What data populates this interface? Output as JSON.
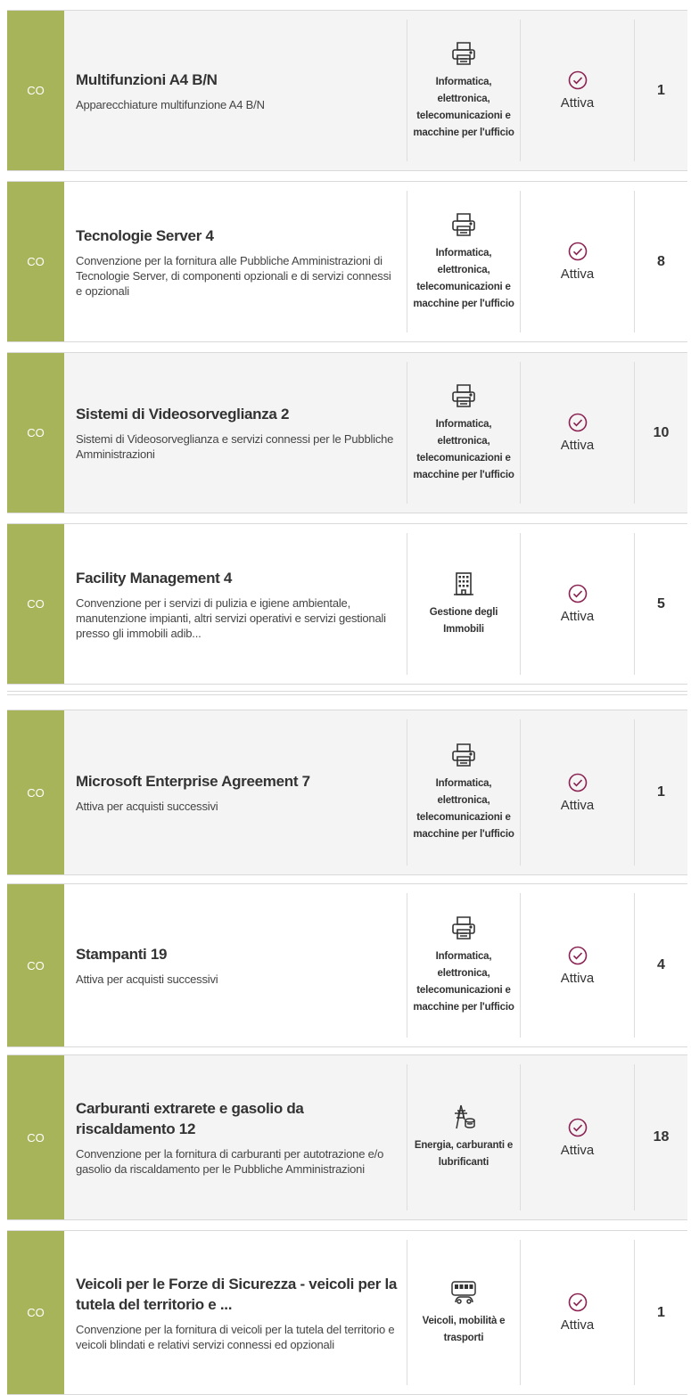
{
  "items": [
    {
      "badge": "CO",
      "title": "Multifunzioni A4 B/N",
      "description": "Apparecchiature multifunzione A4 B/N",
      "category": "Informatica, elettronica, telecomunicazioni e macchine per l'ufficio",
      "category_icon": "printer-icon",
      "status": "Attiva",
      "count": "1"
    },
    {
      "badge": "CO",
      "title": "Tecnologie Server 4",
      "description": "Convenzione per la fornitura alle Pubbliche Amministrazioni di Tecnologie Server, di componenti opzionali e di servizi connessi e opzionali",
      "category": "Informatica, elettronica, telecomunicazioni e macchine per l'ufficio",
      "category_icon": "printer-icon",
      "status": "Attiva",
      "count": "8"
    },
    {
      "badge": "CO",
      "title": "Sistemi di Videosorveglianza 2",
      "description": "Sistemi di Videosorveglianza e servizi connessi per le Pubbliche Amministrazioni",
      "category": "Informatica, elettronica, telecomunicazioni e macchine per l'ufficio",
      "category_icon": "printer-icon",
      "status": "Attiva",
      "count": "10"
    },
    {
      "badge": "CO",
      "title": "Facility Management 4",
      "description": "Convenzione per i servizi di pulizia e igiene ambientale, manutenzione impianti, altri servizi operativi e servizi gestionali presso gli immobili adib...",
      "category": "Gestione degli Immobili",
      "category_icon": "building-icon",
      "status": "Attiva",
      "count": "5"
    },
    {
      "badge": "CO",
      "title": "Microsoft Enterprise Agreement 7",
      "description": "Attiva per acquisti successivi",
      "category": "Informatica, elettronica, telecomunicazioni e macchine per l'ufficio",
      "category_icon": "printer-icon",
      "status": "Attiva",
      "count": "1"
    },
    {
      "badge": "CO",
      "title": "Stampanti 19",
      "description": "Attiva per acquisti successivi",
      "category": "Informatica, elettronica, telecomunicazioni e macchine per l'ufficio",
      "category_icon": "printer-icon",
      "status": "Attiva",
      "count": "4"
    },
    {
      "badge": "CO",
      "title": "Carburanti extrarete e gasolio da riscaldamento 12",
      "description": "Convenzione per la fornitura di carburanti per autotrazione e/o gasolio da riscaldamento per le Pubbliche Amministrazioni",
      "category": "Energia, carburanti e lubrificanti",
      "category_icon": "energy-tower-icon",
      "status": "Attiva",
      "count": "18"
    },
    {
      "badge": "CO",
      "title": "Veicoli per le Forze di Sicurezza - veicoli per la tutela del territorio e ...",
      "description": "Convenzione per la fornitura di veicoli per la tutela del territorio e veicoli blindati e relativi servizi connessi ed opzionali",
      "category": "Veicoli, mobilità e trasporti",
      "category_icon": "vehicles-icon",
      "status": "Attiva",
      "count": "1"
    }
  ],
  "colors": {
    "badge": "#a8b45a",
    "status_icon": "#8a2252",
    "row_gray": "#f4f4f4"
  }
}
